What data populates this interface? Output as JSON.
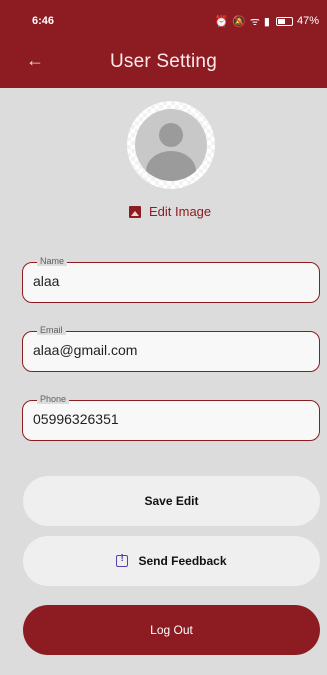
{
  "status_bar": {
    "time": "6:46",
    "battery": "47%"
  },
  "appbar": {
    "title": "User Setting"
  },
  "profile": {
    "edit_image_label": "Edit Image"
  },
  "fields": {
    "name": {
      "label": "Name",
      "value": "alaa"
    },
    "email": {
      "label": "Email",
      "value": "alaa@gmail.com"
    },
    "phone": {
      "label": "Phone",
      "value": "05996326351"
    }
  },
  "actions": {
    "save_label": "Save Edit",
    "feedback_label": "Send Feedback",
    "logout_label": "Log Out"
  },
  "colors": {
    "primary": "#8c1c22",
    "background": "#dcdcdc",
    "button_light": "#efefef"
  },
  "icons": {
    "back": "arrow-left-icon",
    "edit_image": "image-icon",
    "feedback": "feedback-icon"
  }
}
